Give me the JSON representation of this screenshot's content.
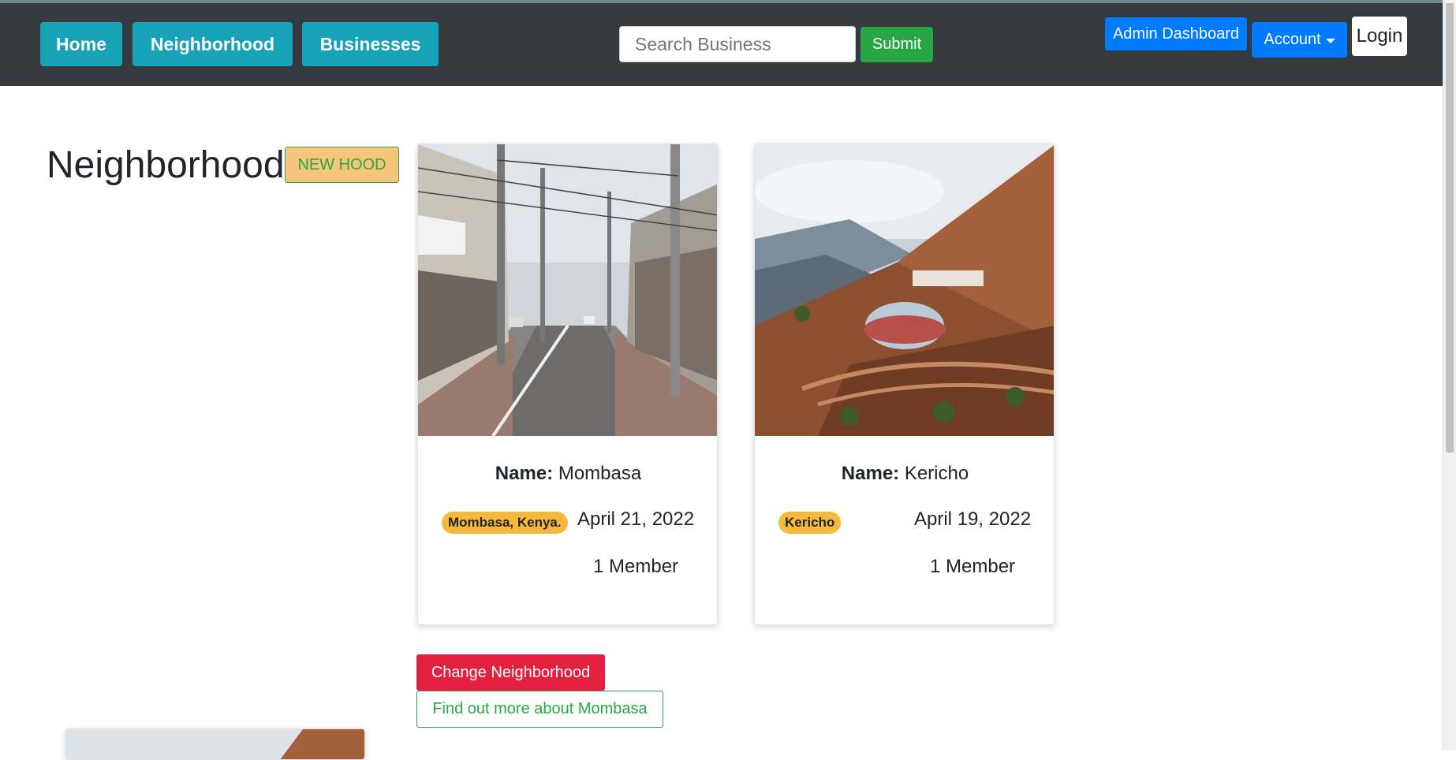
{
  "navbar": {
    "home_label": "Home",
    "neighborhood_label": "Neighborhood",
    "businesses_label": "Businesses",
    "search_placeholder": "Search Business",
    "submit_label": "Submit",
    "admin_label": "Admin Dashboard",
    "account_label": "Account",
    "login_label": "Login"
  },
  "main": {
    "title": "Neighborhood",
    "new_hood_label": "NEW HOOD",
    "change_label": "Change Neighborhood",
    "find_out_label": "Find out more about Mombasa"
  },
  "cards": [
    {
      "name_label": "Name:",
      "name": "Mombasa",
      "location": "Mombasa, Kenya.",
      "date": "April 21, 2022",
      "members": "1 Member",
      "image": "street-photo"
    },
    {
      "name_label": "Name:",
      "name": "Kericho",
      "location": "Kericho",
      "date": "April 19, 2022",
      "members": "1 Member",
      "image": "mountain-dome-photo"
    }
  ],
  "colors": {
    "navbar_bg": "#343a40",
    "nav_button": "#17a2b8",
    "submit": "#28a745",
    "primary": "#007bff",
    "danger": "#e3213f",
    "badge": "#f6b93b"
  }
}
